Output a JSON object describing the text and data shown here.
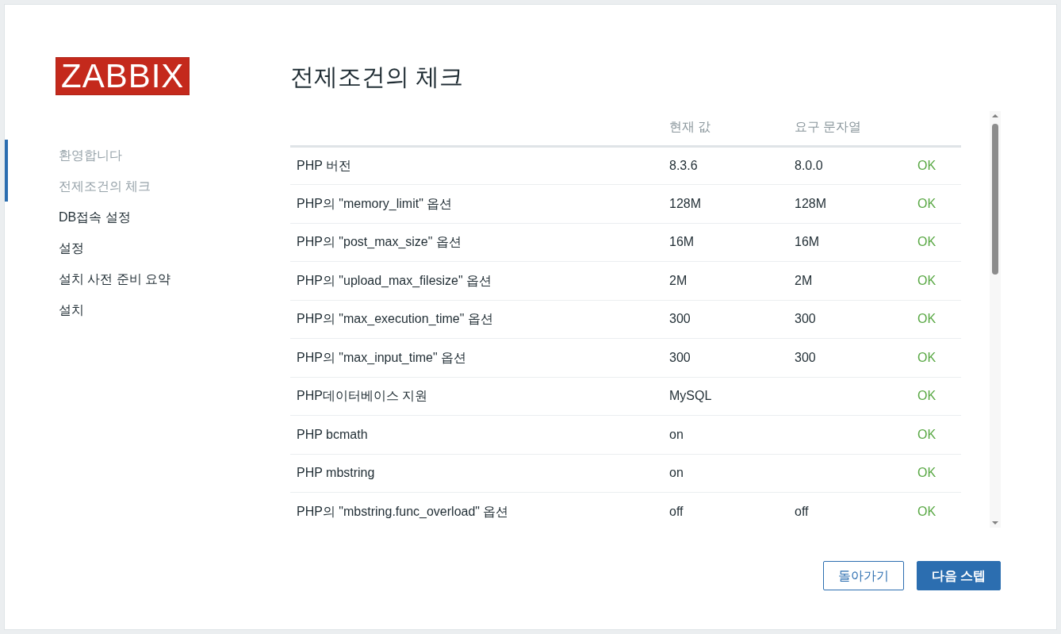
{
  "logo": "ZABBIX",
  "steps": [
    {
      "label": "환영합니다",
      "done": true
    },
    {
      "label": "전제조건의 체크",
      "done": true
    },
    {
      "label": "DB접속 설정",
      "done": false
    },
    {
      "label": "설정",
      "done": false
    },
    {
      "label": "설치 사전 준비 요약",
      "done": false
    },
    {
      "label": "설치",
      "done": false
    }
  ],
  "title": "전제조건의 체크",
  "table": {
    "columns": [
      "현재 값",
      "요구 문자열"
    ],
    "rows": [
      {
        "name": "PHP 버전",
        "current": "8.3.6",
        "required": "8.0.0",
        "status": "OK",
        "ok": true
      },
      {
        "name": "PHP의 \"memory_limit\" 옵션",
        "current": "128M",
        "required": "128M",
        "status": "OK",
        "ok": true
      },
      {
        "name": "PHP의 \"post_max_size\" 옵션",
        "current": "16M",
        "required": "16M",
        "status": "OK",
        "ok": true
      },
      {
        "name": "PHP의 \"upload_max_filesize\" 옵션",
        "current": "2M",
        "required": "2M",
        "status": "OK",
        "ok": true
      },
      {
        "name": "PHP의 \"max_execution_time\" 옵션",
        "current": "300",
        "required": "300",
        "status": "OK",
        "ok": true
      },
      {
        "name": "PHP의 \"max_input_time\" 옵션",
        "current": "300",
        "required": "300",
        "status": "OK",
        "ok": true
      },
      {
        "name": "PHP데이터베이스 지원",
        "current": "MySQL",
        "status": "OK",
        "ok": true
      },
      {
        "name": "PHP bcmath",
        "current": "on",
        "status": "OK",
        "ok": true
      },
      {
        "name": "PHP mbstring",
        "current": "on",
        "status": "OK",
        "ok": true
      },
      {
        "name": "PHP의 \"mbstring.func_overload\" 옵션",
        "current": "off",
        "required": "off",
        "status": "OK",
        "ok": true
      }
    ]
  },
  "buttons": [
    {
      "label": "돌아가기",
      "kind": "secondary"
    },
    {
      "label": "다음 스텝",
      "kind": "primary"
    }
  ]
}
